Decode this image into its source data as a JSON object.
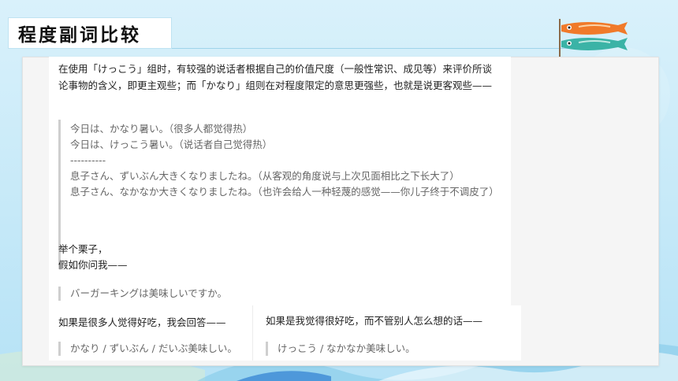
{
  "slide": {
    "title": "程度副词比较"
  },
  "doc": {
    "intro": "在使用「けっこう」组时，有较强的说话者根据自己的价值尺度（一般性常识、成见等）来评价所谈论事物的含义，即更主观些；而「かなり」组则在对程度限定的意思更强些，也就是说更客观些——",
    "examples": [
      "今日は、かなり暑い。（很多人都觉得热）",
      "今日は、けっこう暑い。（说话者自己觉得热）",
      "----------",
      "息子さん、ずいぶん大きくなりましたね。（从客观的角度说与上次见面相比之下长大了）",
      "息子さん、なかなか大きくなりましたね。（也许会给人一种轻蔑的感觉——你儿子终于不调皮了）"
    ],
    "example_lead_1": "举个栗子，",
    "example_lead_2": "假如你问我——",
    "question": "バーガーキングは美味しいですか。",
    "left_answer_label": "如果是很多人觉得好吃，我会回答——",
    "left_answer": "かなり / ずいぶん / だいぶ美味しい。",
    "right_answer_label": "如果是我觉得很好吃，而不管别人怎么想的话——",
    "right_answer": "けっこう / なかなか美味しい。"
  },
  "colors": {
    "background": "#c6e9f8",
    "accent_line": "#9fd4ea",
    "quote_border": "#cfcfcf",
    "carp_orange": "#f07a2a",
    "carp_teal": "#3bb3a6"
  },
  "icons": [
    "koinobori-carp-streamer-icon"
  ]
}
